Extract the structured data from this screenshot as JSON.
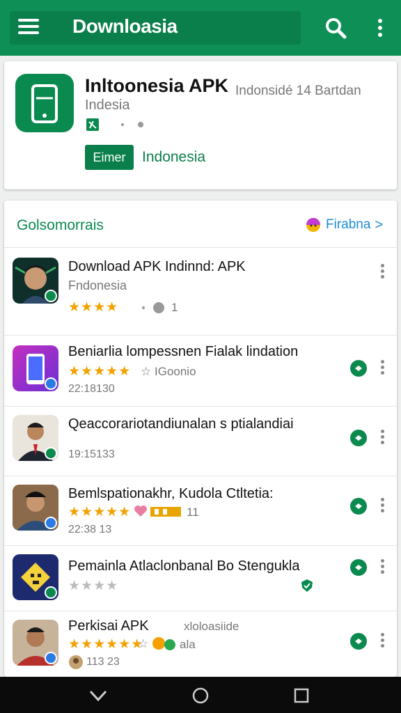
{
  "appbar": {
    "title": "Downloasia",
    "menu_icon": "menu-icon",
    "search_icon": "search-icon",
    "more_icon": "more-vert-icon",
    "color": "#0d8f55"
  },
  "hero": {
    "name": "Inltoonesia APK",
    "subtitle": "Indesia",
    "side_note": "Indonsidé 14 Bartdan",
    "enter_label": "Eimer",
    "country": "Indonesia",
    "accent": "#0a7f4b"
  },
  "section": {
    "title": "Golsomorrais",
    "link_label": "Firabna",
    "link_chevron": ">"
  },
  "apps": [
    {
      "name": "Download APK Indinnd: APK",
      "developer": "Fndonesia",
      "stars": "★★★★",
      "extra": "1",
      "size": ""
    },
    {
      "name": "Beniarlia lompessnen Fialak lindation",
      "developer": "",
      "stars": "★★★★★",
      "extra": "IGoonio",
      "size": "22:18130"
    },
    {
      "name": "Qeaccorariotandiunalan s ptialandiai",
      "developer": "",
      "stars": "",
      "extra": "",
      "size": "19:15133"
    },
    {
      "name": "Bemlspationakhr, Kudola Ctltetia:",
      "developer": "",
      "stars": "★★★★★",
      "extra": "11",
      "size": "22:38 13"
    },
    {
      "name": "Pemainla Atlaclonbanal Bo Stengukla",
      "developer": "",
      "stars": "★★★★",
      "extra": "",
      "size": ""
    },
    {
      "name": "Perkisai APK",
      "developer": "",
      "stars": "★★★★★★",
      "extra": "ala",
      "size": "113 23",
      "side": "xloloasiide"
    }
  ]
}
